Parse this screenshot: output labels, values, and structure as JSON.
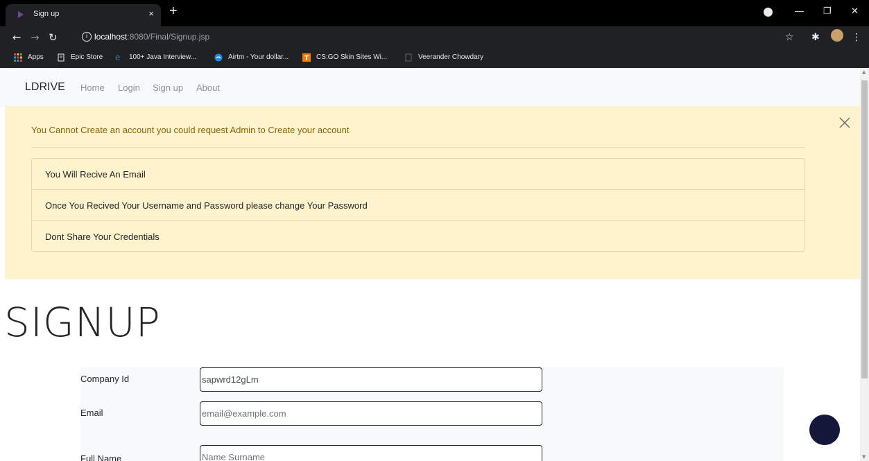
{
  "browser": {
    "tab_title": "Sign up",
    "tab_close": "×",
    "new_tab": "+",
    "url_host": "localhost",
    "url_path": ":8080/Final/Signup.jsp",
    "bookmarks": [
      {
        "label": "Apps",
        "icon": "apps-grid-icon"
      },
      {
        "label": "Epic Store",
        "icon": "epic-store-icon"
      },
      {
        "label": "100+ Java Interview...",
        "icon": "edge-icon"
      },
      {
        "label": "Airtm - Your dollar...",
        "icon": "airtm-icon"
      },
      {
        "label": "CS:GO Skin Sites Wi...",
        "icon": "t-icon"
      },
      {
        "label": "Veerander Chowdary",
        "icon": "blank-page-icon"
      }
    ],
    "colors": {
      "chrome_dark": "#202124",
      "tab_bar": "#000000"
    }
  },
  "navbar": {
    "brand": "LDRIVE",
    "links": [
      "Home",
      "Login",
      "Sign up",
      "About"
    ]
  },
  "alert": {
    "message": "You Cannot Create an account you could request Admin to Create your account",
    "items": [
      "You Will Recive An Email",
      "Once You Recived Your Username and Password please change Your Password",
      "Dont Share Your Credentials"
    ],
    "colors": {
      "background": "#fff3cd",
      "text": "#856404"
    }
  },
  "signup": {
    "title": "SIGNUP",
    "fields": [
      {
        "label": "Company Id",
        "value": "sapwrd12gLm",
        "placeholder": ""
      },
      {
        "label": "Email",
        "value": "",
        "placeholder": "email@example.com"
      },
      {
        "label": "Full Name",
        "value": "",
        "placeholder": "Name Surname"
      }
    ]
  },
  "fab": {
    "color": "#14173a"
  }
}
